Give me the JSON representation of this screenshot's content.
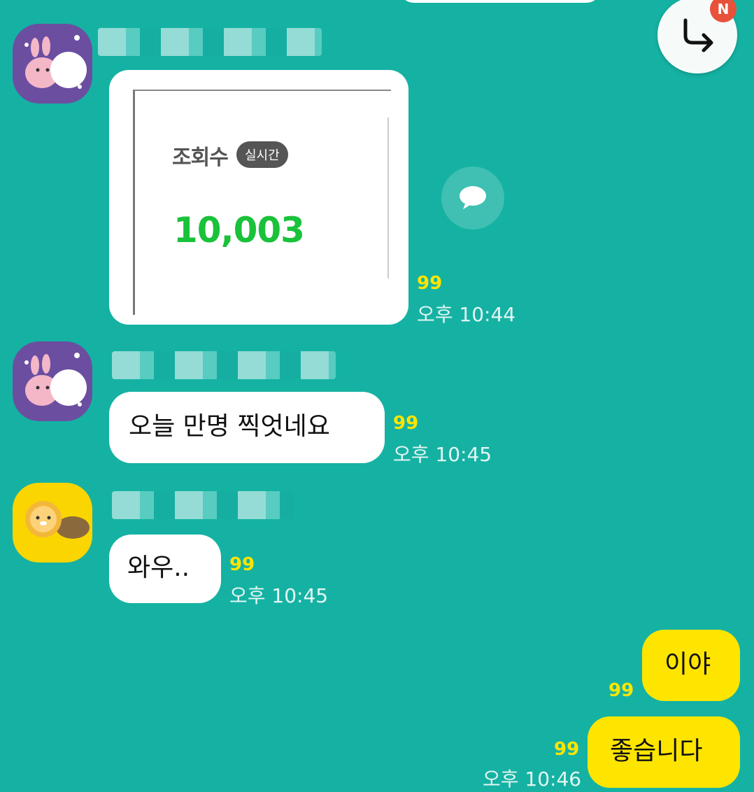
{
  "chat": {
    "jump_badge": "N",
    "messages": [
      {
        "type": "image",
        "image": {
          "views_label": "조회수",
          "live_label": "실시간",
          "views_count": "10,003"
        },
        "read_count": "99",
        "time": "오후 10:44"
      },
      {
        "type": "text",
        "text": "오늘 만명 찍엇네요",
        "read_count": "99",
        "time": "오후 10:45"
      },
      {
        "type": "text",
        "text": "와우..",
        "read_count": "99",
        "time": "오후 10:45"
      },
      {
        "type": "text",
        "outgoing": true,
        "text": "이야",
        "read_count": "99"
      },
      {
        "type": "text",
        "outgoing": true,
        "text": "좋습니다",
        "read_count": "99",
        "time": "오후 10:46"
      }
    ]
  },
  "colors": {
    "background": "#15b2a3",
    "incoming_bubble": "#ffffff",
    "outgoing_bubble": "#fee500",
    "read_count": "#fee500",
    "new_badge": "#e8513a",
    "views_count": "#19c23a"
  },
  "icons": [
    "reply-arrow-icon",
    "share-chat-icon"
  ]
}
